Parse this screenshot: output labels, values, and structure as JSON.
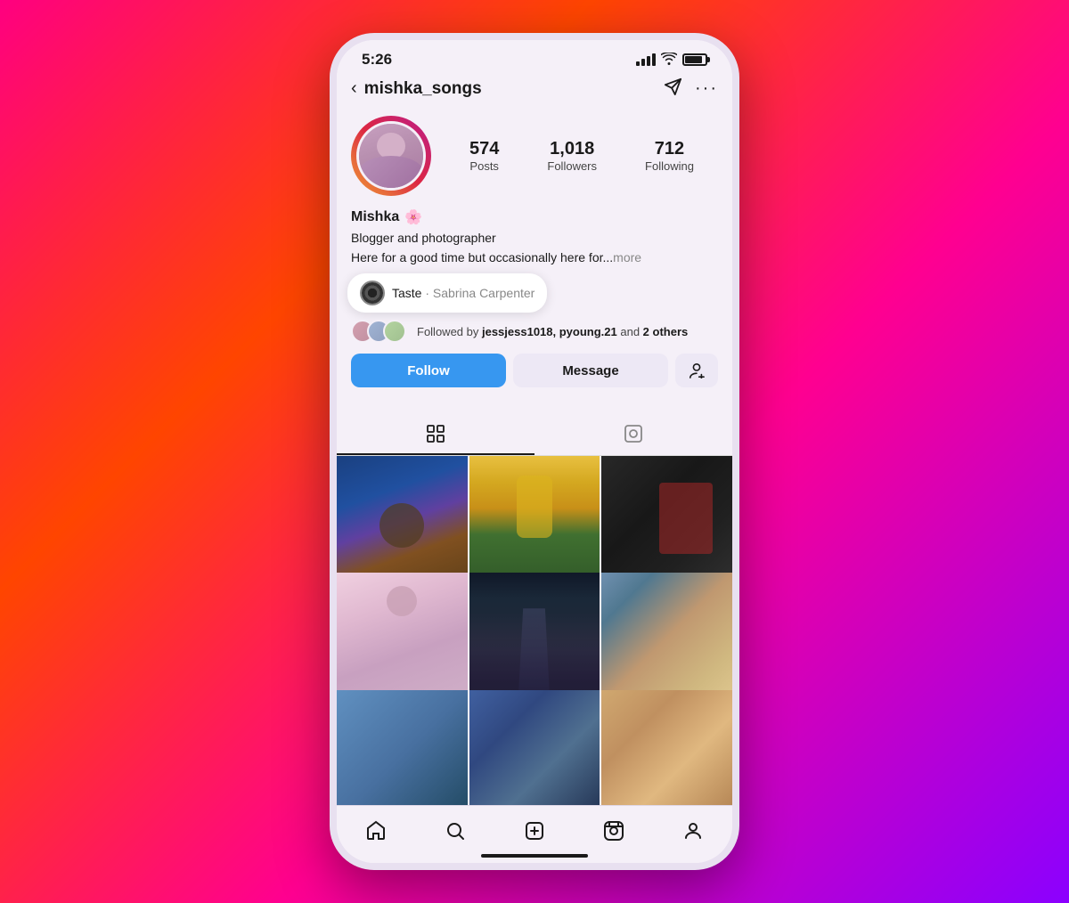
{
  "statusBar": {
    "time": "5:26"
  },
  "header": {
    "username": "mishka_songs",
    "backLabel": "‹",
    "dmIcon": "direct-message",
    "moreIcon": "more-options"
  },
  "profile": {
    "name": "Mishka",
    "verified_emoji": "🌸",
    "bio_line1": "Blogger and photographer",
    "bio_line2": "Here for a good time but occasionally here for...",
    "bio_more": "more",
    "stats": {
      "posts_count": "574",
      "posts_label": "Posts",
      "followers_count": "1,018",
      "followers_label": "Followers",
      "following_count": "712",
      "following_label": "Following"
    }
  },
  "musicTooltip": {
    "title": "Taste",
    "separator": "·",
    "artist": "Sabrina Carpenter"
  },
  "followedBy": {
    "text_prefix": "Followed by",
    "users": "jessjess1018, pyoung.21",
    "text_suffix": "and",
    "others_count": "2",
    "others_label": "others"
  },
  "buttons": {
    "follow": "Follow",
    "message": "Message",
    "addUser": "+"
  },
  "tabs": {
    "grid_label": "Grid",
    "tag_label": "Tagged"
  },
  "bottomNav": {
    "home": "Home",
    "search": "Search",
    "create": "Create",
    "reels": "Reels",
    "profile": "Profile"
  }
}
